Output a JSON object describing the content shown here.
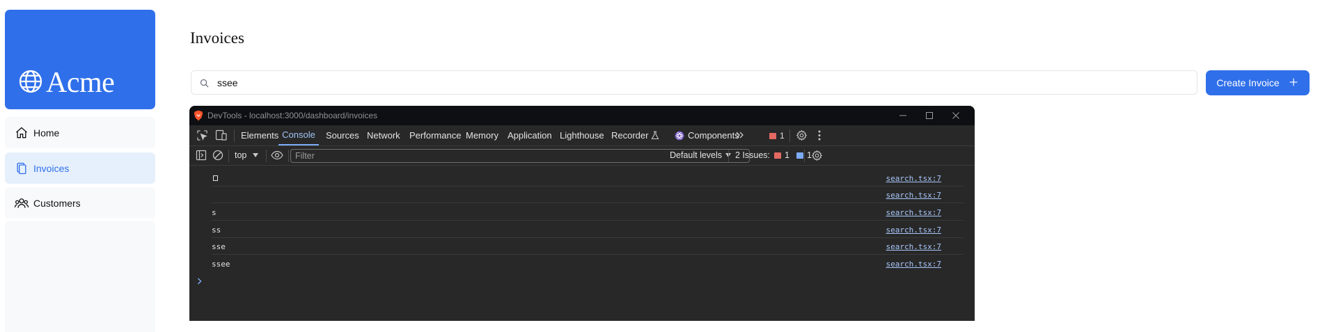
{
  "app": {
    "logo_text": "Acme",
    "brand_color": "#2f6fea",
    "nav": [
      {
        "label": "Home",
        "icon": "home-icon",
        "active": false
      },
      {
        "label": "Invoices",
        "icon": "document-duplicate-icon",
        "active": true
      },
      {
        "label": "Customers",
        "icon": "user-group-icon",
        "active": false
      }
    ],
    "page_title": "Invoices",
    "search": {
      "value": "ssee"
    },
    "create_button": {
      "label": "Create Invoice",
      "icon": "plus-icon"
    }
  },
  "devtools": {
    "window_title": "DevTools - localhost:3000/dashboard/invoices",
    "tabs": [
      {
        "label": "Elements",
        "active": false
      },
      {
        "label": "Console",
        "active": true
      },
      {
        "label": "Sources",
        "active": false
      },
      {
        "label": "Network",
        "active": false
      },
      {
        "label": "Performance",
        "active": false
      },
      {
        "label": "Memory",
        "active": false
      },
      {
        "label": "Application",
        "active": false
      },
      {
        "label": "Lighthouse",
        "active": false
      },
      {
        "label": "Recorder",
        "active": false
      },
      {
        "label": "Components",
        "active": false
      }
    ],
    "error_badge_count": "1",
    "console_toolbar": {
      "context": "top",
      "filter_placeholder": "Filter",
      "levels": "Default levels",
      "issues_label": "2 Issues:",
      "issues_errors": "1",
      "issues_info": "1"
    },
    "logs": [
      {
        "message": "",
        "source": "search.tsx:7",
        "empty_glyph": true
      },
      {
        "message": "",
        "source": "search.tsx:7",
        "empty_glyph": false
      },
      {
        "message": "s",
        "source": "search.tsx:7",
        "empty_glyph": false
      },
      {
        "message": "ss",
        "source": "search.tsx:7",
        "empty_glyph": false
      },
      {
        "message": "sse",
        "source": "search.tsx:7",
        "empty_glyph": false
      },
      {
        "message": "ssee",
        "source": "search.tsx:7",
        "empty_glyph": false
      }
    ]
  }
}
